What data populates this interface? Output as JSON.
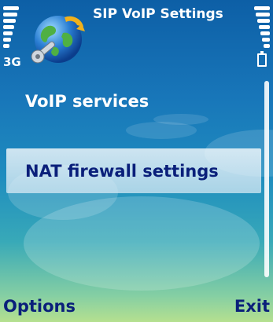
{
  "status_bar": {
    "network": "3G",
    "signal_level": 0.8,
    "battery_level": 0.8
  },
  "header": {
    "title": "SIP VoIP Settings",
    "app_icon": "globe-wrench-icon"
  },
  "menu": {
    "items": [
      {
        "label": "VoIP services",
        "selected": false
      },
      {
        "label": "NAT firewall settings",
        "selected": true
      }
    ]
  },
  "softkeys": {
    "left": "Options",
    "right": "Exit"
  },
  "colors": {
    "background_top": "#0d5fa6",
    "background_bottom": "#b5e08f",
    "selected_text": "#0a1f7a",
    "softkey_text": "#0a1f7a",
    "text": "#ffffff"
  }
}
